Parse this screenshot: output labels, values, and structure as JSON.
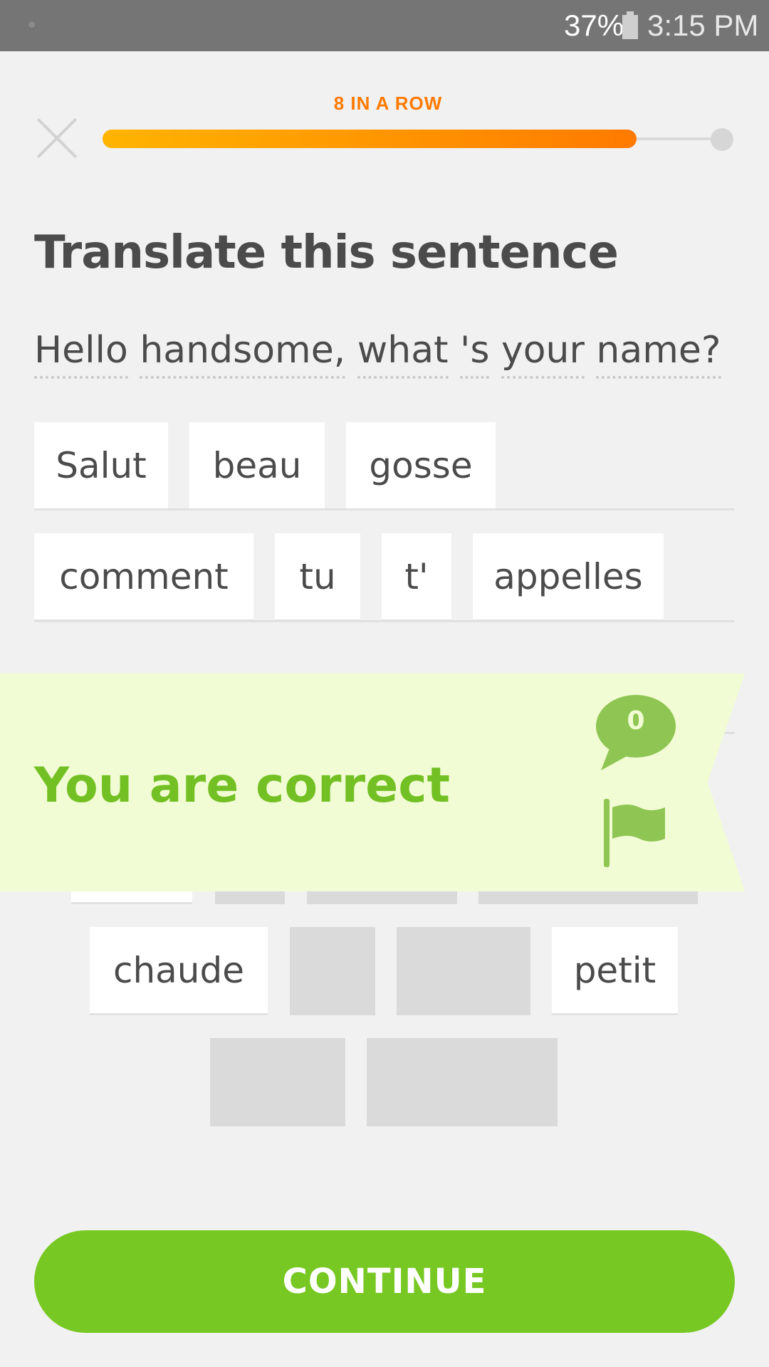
{
  "status_bar": {
    "battery": "37%",
    "time": "3:15 PM"
  },
  "header": {
    "streak": "8 IN A ROW",
    "progress": 0.86
  },
  "title": "Translate this sentence",
  "prompt_words": [
    "Hello",
    "handsome,",
    "what",
    "'s",
    "your",
    "name?"
  ],
  "answer_tiles": [
    "Salut",
    "beau",
    "gosse",
    "comment",
    "tu",
    "t'",
    "appelles"
  ],
  "word_bank": [
    "chaude",
    "petit"
  ],
  "feedback": {
    "message": "You are correct",
    "comment_count": "0"
  },
  "continue_label": "CONTINUE",
  "colors": {
    "accent_green": "#78c823",
    "correct_text": "#73c024",
    "streak_orange": "#ff7a00"
  }
}
